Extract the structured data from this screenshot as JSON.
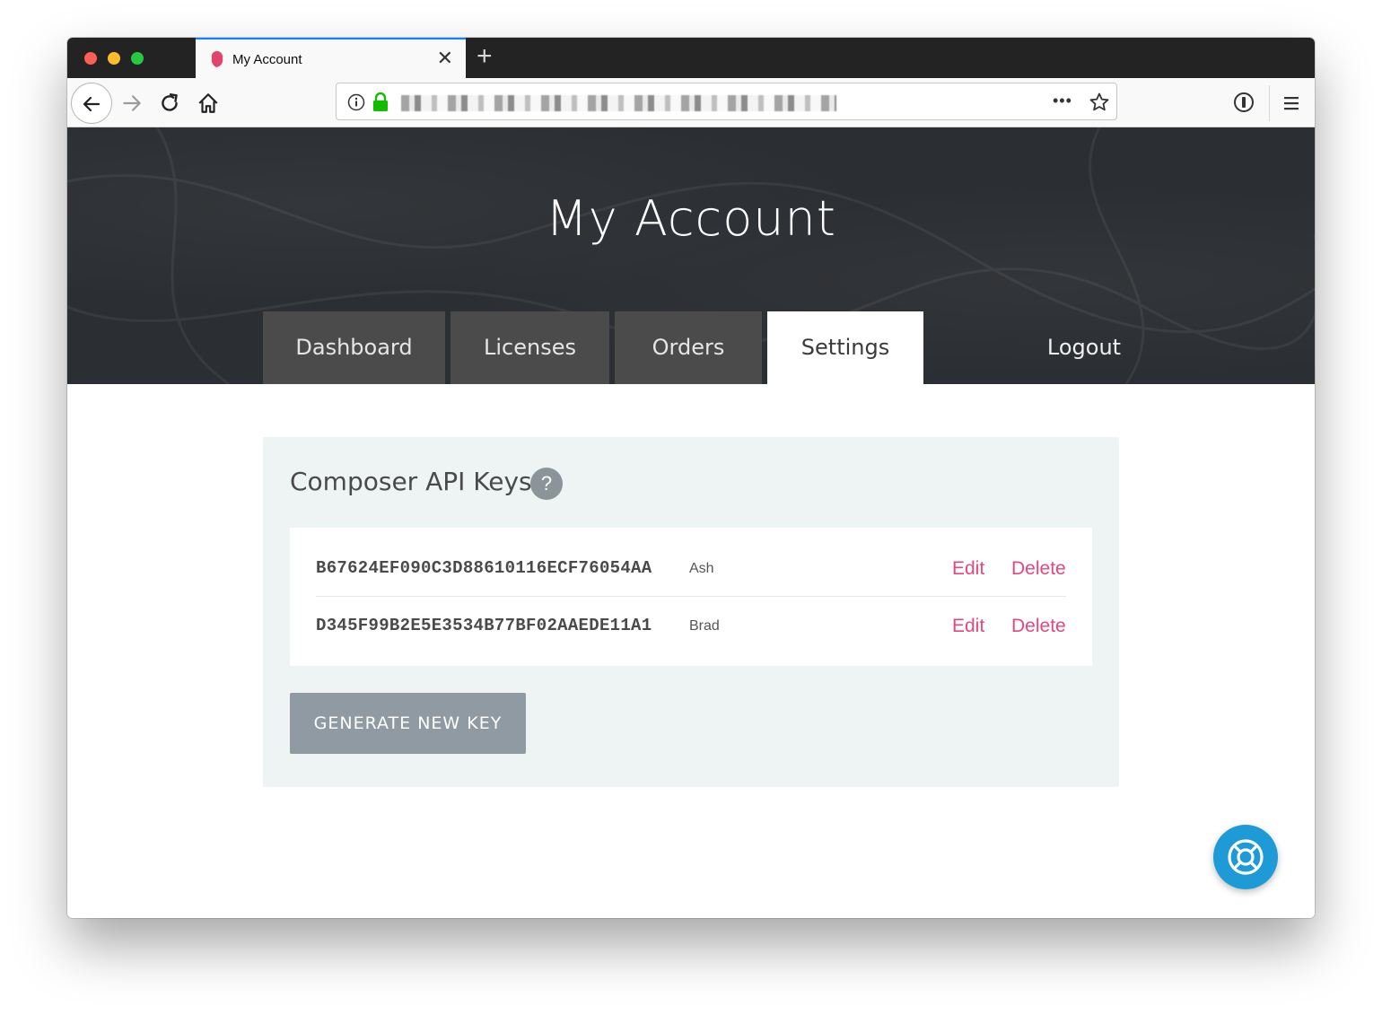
{
  "browser": {
    "tab_title": "My Account",
    "new_tab_symbol": "+",
    "close_symbol": "✕",
    "more_symbol": "•••"
  },
  "page": {
    "hero_title": "My Account",
    "tabs": [
      {
        "label": "Dashboard",
        "active": false
      },
      {
        "label": "Licenses",
        "active": false
      },
      {
        "label": "Orders",
        "active": false
      },
      {
        "label": "Settings",
        "active": true
      },
      {
        "label": "Logout",
        "active": false
      }
    ],
    "section_title": "Composer API Keys",
    "help_symbol": "?",
    "keys": [
      {
        "key": "B67624EF090C3D88610116ECF76054AA",
        "owner": "Ash",
        "edit": "Edit",
        "delete": "Delete"
      },
      {
        "key": "D345F99B2E5E3534B77BF02AAEDE11A1",
        "owner": "Brad",
        "edit": "Edit",
        "delete": "Delete"
      }
    ],
    "generate_button": "GENERATE NEW KEY"
  },
  "colors": {
    "accent_link": "#e8467c",
    "hero_bg": "#2b2e32",
    "tab_bg": "#4b4b4b",
    "panel_bg": "#eef3f3",
    "button_bg": "#8f9aa3",
    "fab_bg": "#1e9bd7"
  },
  "icons": [
    "back-arrow-icon",
    "forward-arrow-icon",
    "reload-icon",
    "home-icon",
    "info-icon",
    "lock-icon",
    "star-icon",
    "password-manager-icon",
    "hamburger-menu-icon",
    "lifebuoy-icon",
    "help-icon",
    "close-icon"
  ]
}
